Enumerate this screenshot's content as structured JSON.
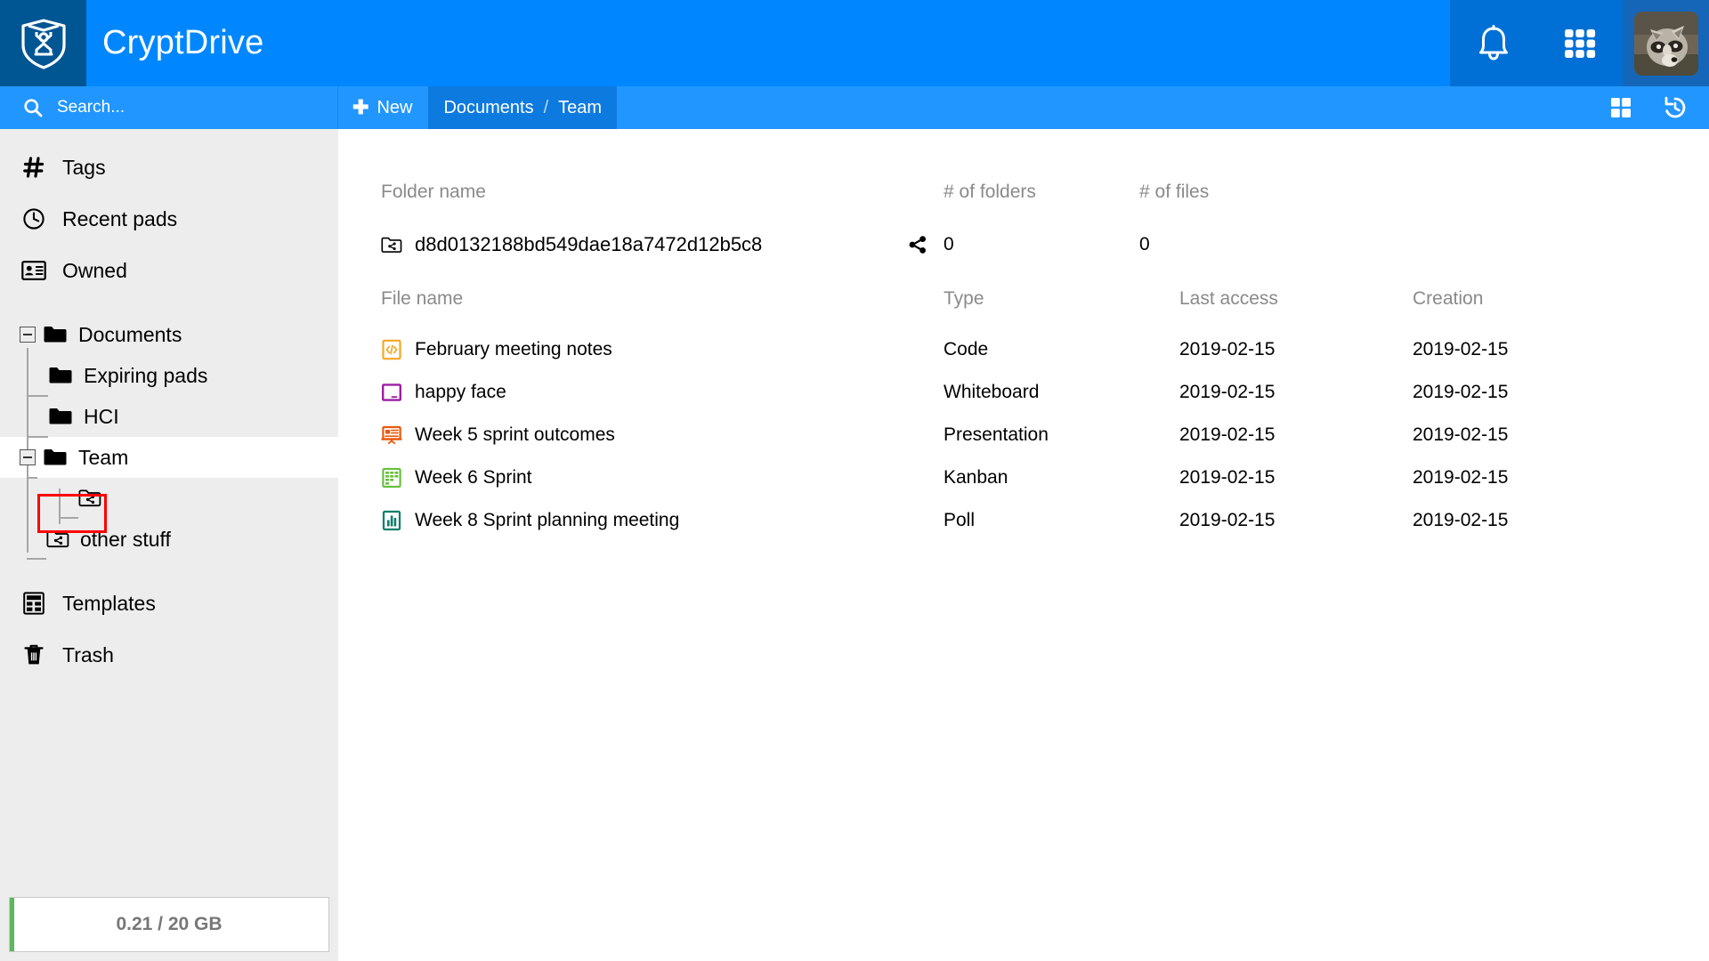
{
  "app": {
    "brand": "CryptDrive",
    "logo_icon": "cryptpad-shield-logo"
  },
  "header": {
    "notifications_icon": "bell-icon",
    "apps_icon": "app-grid-icon",
    "avatar_icon": "user-avatar-raccoon"
  },
  "toolbar": {
    "search_icon": "search-icon",
    "search_placeholder": "Search...",
    "search_value": "",
    "new_label": "New",
    "new_icon": "plus-icon",
    "breadcrumb": [
      "Documents",
      "Team"
    ],
    "breadcrumb_separator": "/",
    "grid_view_icon": "grid-view-icon",
    "history_icon": "history-restore-icon"
  },
  "sidebar": {
    "nav": [
      {
        "label": "Tags",
        "icon": "hash-tag-icon"
      },
      {
        "label": "Recent pads",
        "icon": "clock-icon"
      },
      {
        "label": "Owned",
        "icon": "id-card-icon"
      }
    ],
    "tree": [
      {
        "label": "Documents",
        "icon": "folder-open-icon",
        "depth": 0,
        "expanded": true,
        "has_toggle": true,
        "selected": false
      },
      {
        "label": "Expiring pads",
        "icon": "folder-icon",
        "depth": 1,
        "expanded": false,
        "has_toggle": false,
        "selected": false
      },
      {
        "label": "HCI",
        "icon": "folder-icon",
        "depth": 1,
        "expanded": false,
        "has_toggle": false,
        "selected": false
      },
      {
        "label": "Team",
        "icon": "folder-open-icon",
        "depth": 1,
        "expanded": true,
        "has_toggle": true,
        "selected": true
      },
      {
        "label": "",
        "icon": "shared-folder-icon",
        "depth": 2,
        "expanded": false,
        "has_toggle": false,
        "selected": false,
        "highlighted": true
      },
      {
        "label": "other stuff",
        "icon": "shared-folder-icon",
        "depth": 2,
        "expanded": false,
        "has_toggle": false,
        "selected": false
      }
    ],
    "footer_nav": [
      {
        "label": "Templates",
        "icon": "templates-icon"
      },
      {
        "label": "Trash",
        "icon": "trash-icon"
      }
    ],
    "storage": {
      "text": "0.21 / 20 GB",
      "used_gb": 0.21,
      "total_gb": 20,
      "bar_color": "#5cb85c"
    }
  },
  "main": {
    "folder_headers": {
      "name": "Folder name",
      "folders": "# of folders",
      "files": "# of files"
    },
    "folders": [
      {
        "name": "d8d0132188bd549dae18a7472d12b5c8",
        "icon": "shared-folder-icon",
        "share_icon": "share-icon",
        "num_folders": "0",
        "num_files": "0"
      }
    ],
    "file_headers": {
      "name": "File name",
      "type": "Type",
      "last_access": "Last access",
      "creation": "Creation"
    },
    "files": [
      {
        "name": "February meeting notes",
        "icon": "code-pad-icon",
        "icon_color": "#f5a623",
        "type": "Code",
        "last_access": "2019-02-15",
        "creation": "2019-02-15"
      },
      {
        "name": "happy face",
        "icon": "whiteboard-pad-icon",
        "icon_color": "#9b1fa0",
        "type": "Whiteboard",
        "last_access": "2019-02-15",
        "creation": "2019-02-15"
      },
      {
        "name": "Week 5 sprint outcomes",
        "icon": "presentation-pad-icon",
        "icon_color": "#e8590c",
        "type": "Presentation",
        "last_access": "2019-02-15",
        "creation": "2019-02-15"
      },
      {
        "name": "Week 6 Sprint",
        "icon": "kanban-pad-icon",
        "icon_color": "#6abf40",
        "type": "Kanban",
        "last_access": "2019-02-15",
        "creation": "2019-02-15"
      },
      {
        "name": "Week 8 Sprint planning meeting",
        "icon": "poll-pad-icon",
        "icon_color": "#0a7f6b",
        "type": "Poll",
        "last_access": "2019-02-15",
        "creation": "2019-02-15"
      }
    ]
  },
  "colors": {
    "header_blue": "#0087ff",
    "logo_blue": "#005593",
    "toolbar_blue": "#2196ff",
    "breadcrumb_blue": "#0d7ae0",
    "sidebar_bg": "#ededed",
    "annotation_red": "#ff0000"
  }
}
